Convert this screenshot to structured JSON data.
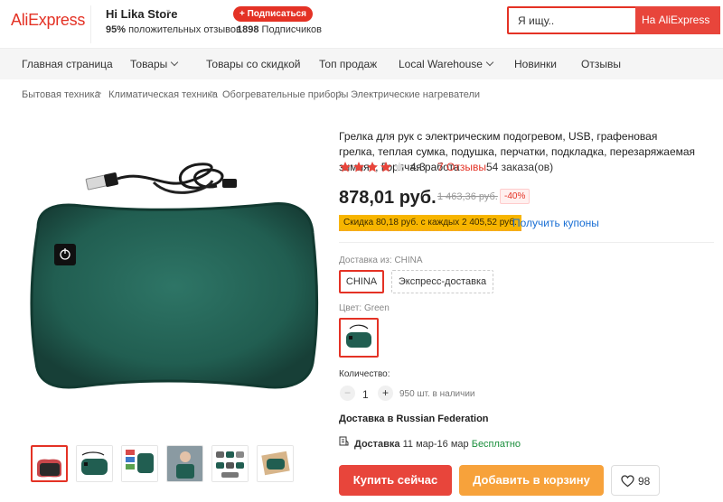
{
  "header": {
    "logo": "AliExpress",
    "store_name": "Hi Lika Store",
    "store_caret": "▾",
    "positive_pct": "95%",
    "positive_label": "положительных отзывов",
    "subscribers_count": "1898",
    "subscribers_label": "Подписчиков",
    "subscribe_label": "+ Подписаться",
    "search_placeholder": "Я ищу..",
    "search_button": "На AliExpress"
  },
  "nav": {
    "items": [
      {
        "label": "Главная страница"
      },
      {
        "label": "Товары"
      },
      {
        "label": "Товары со скидкой"
      },
      {
        "label": "Топ продаж"
      },
      {
        "label": "Local Warehouse"
      },
      {
        "label": "Новинки"
      },
      {
        "label": "Отзывы"
      }
    ]
  },
  "breadcrumb": [
    "Бытовая техника",
    "Климатическая техника",
    "Обогревательные приборы",
    "Электрические нагреватели"
  ],
  "breadcrumb_sep": ">",
  "product": {
    "title": "Грелка для рук с электрическим подогревом, USB, графеновая грелка, теплая сумка, подушка, перчатки, подкладка, перезаряжаемая зимняя, Горячая работа",
    "rating": "4.3",
    "rating_value": 4.3,
    "reviews": "7 Отзывы",
    "orders": "54 заказа(ов)",
    "price": "878,01 руб.",
    "old_price": "1 463,36 руб.",
    "discount": "-40%",
    "coupon": "Скидка 80,18 руб. с каждых 2 405,52 руб.",
    "coupon_link": "Получить купоны",
    "ship_from_label": "Доставка из:",
    "ship_from_value": "CHINA",
    "ship_options": [
      "CHINA",
      "Экспресс-доставка"
    ],
    "color_label": "Цвет:",
    "color_value": "Green",
    "quantity_label": "Количество:",
    "quantity": "1",
    "qty_minus": "−",
    "qty_plus": "+",
    "stock": "950 шт. в наличии",
    "deliver_to": "Доставка в Russian Federation",
    "delivery_label": "Доставка",
    "delivery_dates": "11 мар-16 мар",
    "delivery_cost": "Бесплатно",
    "buy_now": "Купить сейчас",
    "add_to_cart": "Добавить в корзину",
    "wishlist_count": "98"
  },
  "colors": {
    "accent": "#e43225",
    "buy": "#e8453b",
    "cart": "#f7a23b",
    "product_green": "#1f5d4f",
    "link": "#1a6fd4",
    "star": "#e8453b"
  }
}
